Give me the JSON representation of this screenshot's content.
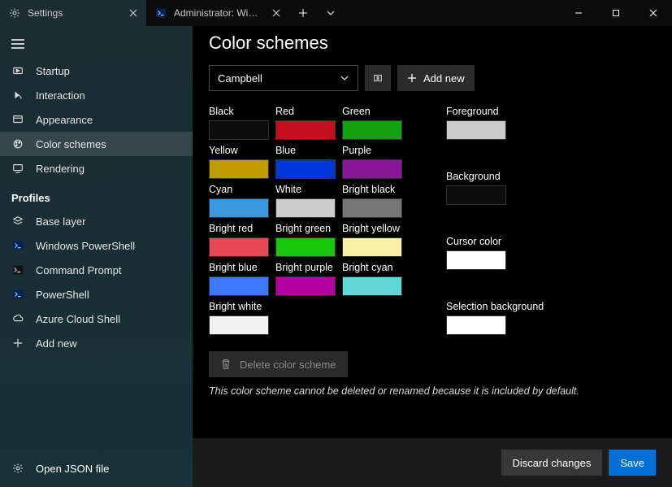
{
  "titlebar": {
    "tabs": [
      {
        "title": "Settings",
        "icon": "gear"
      },
      {
        "title": "Administrator: Windows PowerS",
        "icon": "ps"
      }
    ]
  },
  "sidebar": {
    "top": [
      {
        "icon": "play",
        "label": "Startup"
      },
      {
        "icon": "interact",
        "label": "Interaction"
      },
      {
        "icon": "appear",
        "label": "Appearance"
      },
      {
        "icon": "palette",
        "label": "Color schemes"
      },
      {
        "icon": "render",
        "label": "Rendering"
      }
    ],
    "profilesHeader": "Profiles",
    "profiles": [
      {
        "icon": "layers",
        "label": "Base layer"
      },
      {
        "icon": "ps",
        "label": "Windows PowerShell"
      },
      {
        "icon": "cmd",
        "label": "Command Prompt"
      },
      {
        "icon": "ps",
        "label": "PowerShell"
      },
      {
        "icon": "cloud",
        "label": "Azure Cloud Shell"
      },
      {
        "icon": "plus",
        "label": "Add new"
      }
    ],
    "footer": {
      "icon": "gear",
      "label": "Open JSON file"
    }
  },
  "page": {
    "title": "Color schemes",
    "selectedScheme": "Campbell",
    "addNew": "Add new",
    "deleteLabel": "Delete color scheme",
    "note": "This color scheme cannot be deleted or renamed because it is included by default.",
    "discard": "Discard changes",
    "save": "Save"
  },
  "swatchesLeft": [
    {
      "label": "Black",
      "color": "#0c0c0c"
    },
    {
      "label": "Red",
      "color": "#c50f1f"
    },
    {
      "label": "Green",
      "color": "#13a10e"
    },
    {
      "label": "Yellow",
      "color": "#c19c00"
    },
    {
      "label": "Blue",
      "color": "#0037da"
    },
    {
      "label": "Purple",
      "color": "#881798"
    },
    {
      "label": "Cyan",
      "color": "#3a96dd"
    },
    {
      "label": "White",
      "color": "#cccccc"
    },
    {
      "label": "Bright black",
      "color": "#767676"
    },
    {
      "label": "Bright red",
      "color": "#e74856"
    },
    {
      "label": "Bright green",
      "color": "#16c60c"
    },
    {
      "label": "Bright yellow",
      "color": "#f9f1a5"
    },
    {
      "label": "Bright blue",
      "color": "#3b78ff"
    },
    {
      "label": "Bright purple",
      "color": "#b4009e"
    },
    {
      "label": "Bright cyan",
      "color": "#61d6d6"
    },
    {
      "label": "Bright white",
      "color": "#f2f2f2"
    }
  ],
  "swatchesRight": [
    {
      "label": "Foreground",
      "color": "#cccccc"
    },
    {
      "label": "Background",
      "color": "#0c0c0c"
    },
    {
      "label": "Cursor color",
      "color": "#ffffff"
    },
    {
      "label": "Selection background",
      "color": "#ffffff"
    }
  ]
}
